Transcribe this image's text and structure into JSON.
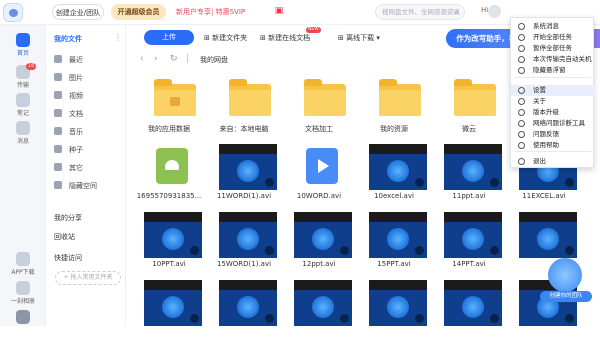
{
  "header": {
    "create_team": "创建企业/团队",
    "open_vip": "开通超级会员",
    "promo_text": "新用户专享| 特惠SVIP",
    "search_placeholder": "搜网盘文件、全网资源资讯",
    "greeting": "Hi"
  },
  "rail": {
    "items": [
      {
        "label": "首页",
        "active": true
      },
      {
        "label": "传输",
        "badge": "16"
      },
      {
        "label": "笔记"
      },
      {
        "label": "消息"
      },
      {
        "label": "APP下载"
      },
      {
        "label": "一刻相册"
      }
    ]
  },
  "sidebar": {
    "title": "我的文件",
    "items": [
      "最近",
      "图片",
      "视频",
      "文档",
      "音乐",
      "种子",
      "其它",
      "隐藏空间"
    ],
    "my_share": "我的分享",
    "recycle": "回收站",
    "quick_access": "快捷访问",
    "add_quick": "+ 拖入常用文件夹"
  },
  "toolbar": {
    "upload": "上传",
    "new_folder": "新建文件夹",
    "new_online_doc": "新建在线文档",
    "new_tag": "NEW",
    "offline_download": "离线下载",
    "promo": "作为改写助手，我会"
  },
  "path": {
    "current": "我的网盘"
  },
  "files": [
    {
      "name": "我的应用数据",
      "kind": "folder-lock"
    },
    {
      "name": "来自：本地电脑",
      "kind": "folder"
    },
    {
      "name": "文档加工",
      "kind": "folder"
    },
    {
      "name": "我的资源",
      "kind": "folder"
    },
    {
      "name": "微云",
      "kind": "folder"
    },
    {
      "name": "",
      "kind": "folder"
    },
    {
      "name": "1695570931835...",
      "kind": "apk"
    },
    {
      "name": "11WORD(1).avi",
      "kind": "video"
    },
    {
      "name": "10WORD.avi",
      "kind": "video-icon"
    },
    {
      "name": "10excel.avi",
      "kind": "video"
    },
    {
      "name": "11ppt.avi",
      "kind": "video"
    },
    {
      "name": "11EXCEL.avi",
      "kind": "video"
    },
    {
      "name": "10PPT.avi",
      "kind": "video"
    },
    {
      "name": "15WORD(1).avi",
      "kind": "video"
    },
    {
      "name": "12ppt.avi",
      "kind": "video"
    },
    {
      "name": "15PPT.avi",
      "kind": "video"
    },
    {
      "name": "14PPT.avi",
      "kind": "video"
    },
    {
      "name": "",
      "kind": "video"
    },
    {
      "name": "",
      "kind": "video"
    },
    {
      "name": "",
      "kind": "video"
    },
    {
      "name": "",
      "kind": "video"
    },
    {
      "name": "",
      "kind": "video"
    },
    {
      "name": "",
      "kind": "video"
    },
    {
      "name": "",
      "kind": "video"
    }
  ],
  "menu": {
    "items": [
      "系统消息",
      "开始全部任务",
      "暂停全部任务",
      "本次传输完自动关机",
      "隐藏悬浮窗",
      "设置",
      "关于",
      "版本升级",
      "网络问题诊断工具",
      "问题反馈",
      "使用帮助",
      "退出"
    ],
    "highlighted": "设置"
  },
  "floating": {
    "label": "创建你的团队"
  },
  "colors": {
    "accent": "#2b6cf6",
    "folder": "#f7c447",
    "menu_highlight": "#e8eefc"
  }
}
